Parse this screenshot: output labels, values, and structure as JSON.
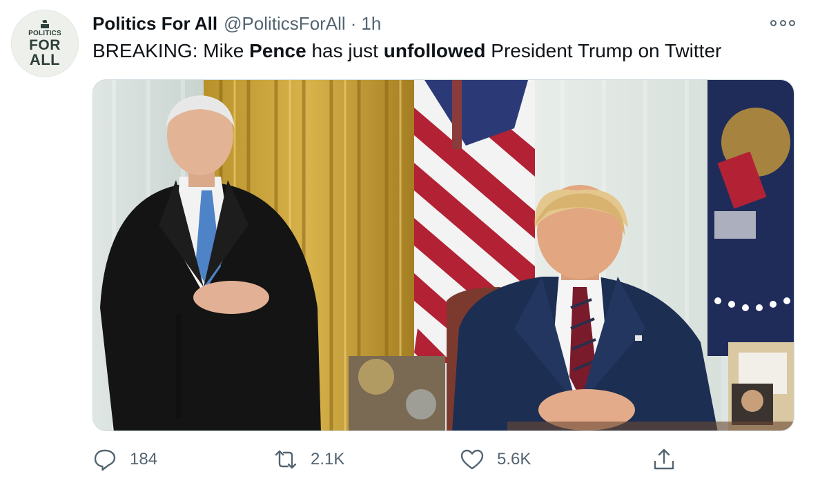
{
  "tweet": {
    "author": {
      "display_name": "Politics For All",
      "handle": "@PoliticsForAll",
      "separator": "·",
      "time": "1h",
      "avatar": {
        "line1": "POLITICS",
        "line2": "FOR",
        "line3": "ALL",
        "icon": "ballot-box-icon"
      }
    },
    "text": {
      "prefix": "BREAKING: Mike ",
      "bold1": "Pence",
      "middle": " has just ",
      "bold2": "unfollowed",
      "suffix": " President Trump on Twitter"
    },
    "media": {
      "alt": ""
    },
    "more_icon": "more-options-icon"
  },
  "actions": {
    "reply": {
      "icon": "reply-icon",
      "count": "184"
    },
    "retweet": {
      "icon": "retweet-icon",
      "count": "2.1K"
    },
    "like": {
      "icon": "heart-icon",
      "count": "5.6K"
    },
    "share": {
      "icon": "share-icon",
      "count": ""
    }
  },
  "colors": {
    "text": "#0f1419",
    "muted": "#536471",
    "border": "#cfd9de",
    "avatar_bg": "#eef0ec",
    "avatar_text": "#2c3f3a"
  }
}
